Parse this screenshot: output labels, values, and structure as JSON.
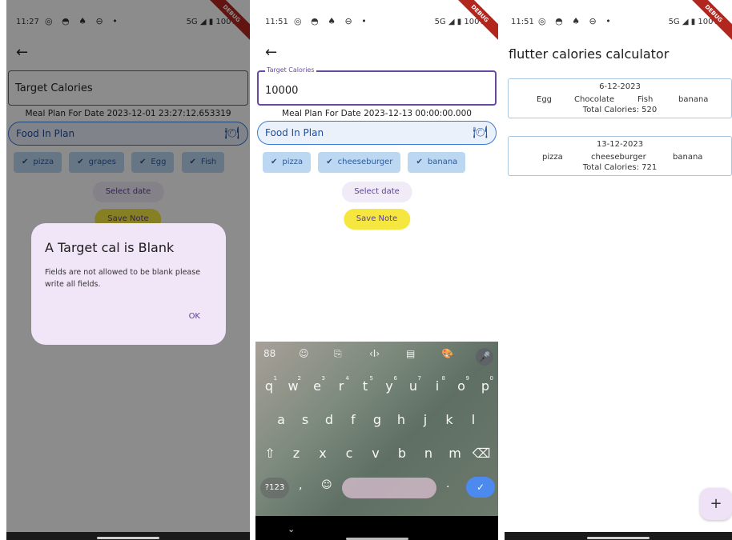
{
  "screen1": {
    "status": {
      "time": "11:27",
      "icons": "◎ ◓ ♠ ⊖ •",
      "network": "5G ◢ ▮ 100%",
      "debug": "DEBUG"
    },
    "back_icon": "←",
    "target_calories_label": "Target Calories",
    "meal_plan_date": "Meal Plan For Date 2023-12-01 23:27:12.653319",
    "food_in_plan_label": "Food In Plan",
    "chips": [
      "pizza",
      "grapes",
      "Egg",
      "Fish"
    ],
    "select_date": "Select date",
    "save_note": "Save Note",
    "dialog": {
      "title": "A Target cal is Blank",
      "body": "Fields are not allowed to be blank please write all fields.",
      "ok": "OK"
    }
  },
  "screen2": {
    "status": {
      "time": "11:51",
      "icons": "◎ ◓ ♠ ⊖ •",
      "network": "5G ◢ ▮ 100%",
      "debug": "DEBUG"
    },
    "back_icon": "←",
    "target_calories_small_label": "Target Calories",
    "target_calories_value": "10000",
    "meal_plan_date": "Meal Plan For Date 2023-12-13 00:00:00.000",
    "food_in_plan_label": "Food In Plan",
    "chips": [
      "pizza",
      "cheeseburger",
      "banana"
    ],
    "select_date": "Select date",
    "save_note": "Save Note",
    "keyboard": {
      "toolbar": [
        "88",
        "☺",
        "⎘",
        "‹I›",
        "▤",
        "🎨",
        "🎤"
      ],
      "row1": [
        "q",
        "w",
        "e",
        "r",
        "t",
        "y",
        "u",
        "i",
        "o",
        "p"
      ],
      "row1_hints": [
        "1",
        "2",
        "3",
        "4",
        "5",
        "6",
        "7",
        "8",
        "9",
        "0"
      ],
      "row2": [
        "a",
        "s",
        "d",
        "f",
        "g",
        "h",
        "j",
        "k",
        "l"
      ],
      "row3": [
        "⇧",
        "z",
        "x",
        "c",
        "v",
        "b",
        "n",
        "m",
        "⌫"
      ],
      "num_key": "?123",
      "comma": ",",
      "emoji": "☺",
      "period": ".",
      "enter": "✓",
      "nav_chevron": "⌄"
    }
  },
  "screen3": {
    "status": {
      "time": "11:51",
      "icons": "◎ ◓ ♠ ⊖ •",
      "network": "5G ◢ ▮ 100%",
      "debug": "DEBUG"
    },
    "title": "flutter calories calculator",
    "cards": [
      {
        "date": "6-12-2023",
        "items": [
          "Egg",
          "Chocolate",
          "Fish",
          "banana"
        ],
        "total": "Total Calories: 520"
      },
      {
        "date": "13-12-2023",
        "items": [
          "pizza",
          "cheeseburger",
          "banana"
        ],
        "total": "Total Calories: 721"
      }
    ],
    "fab": "+"
  },
  "colors": {
    "accent_purple": "#6a4aa0",
    "chip_blue": "#bcd7f2",
    "save_yellow": "#f5e740",
    "dialog_bg": "#f1e5f8"
  }
}
